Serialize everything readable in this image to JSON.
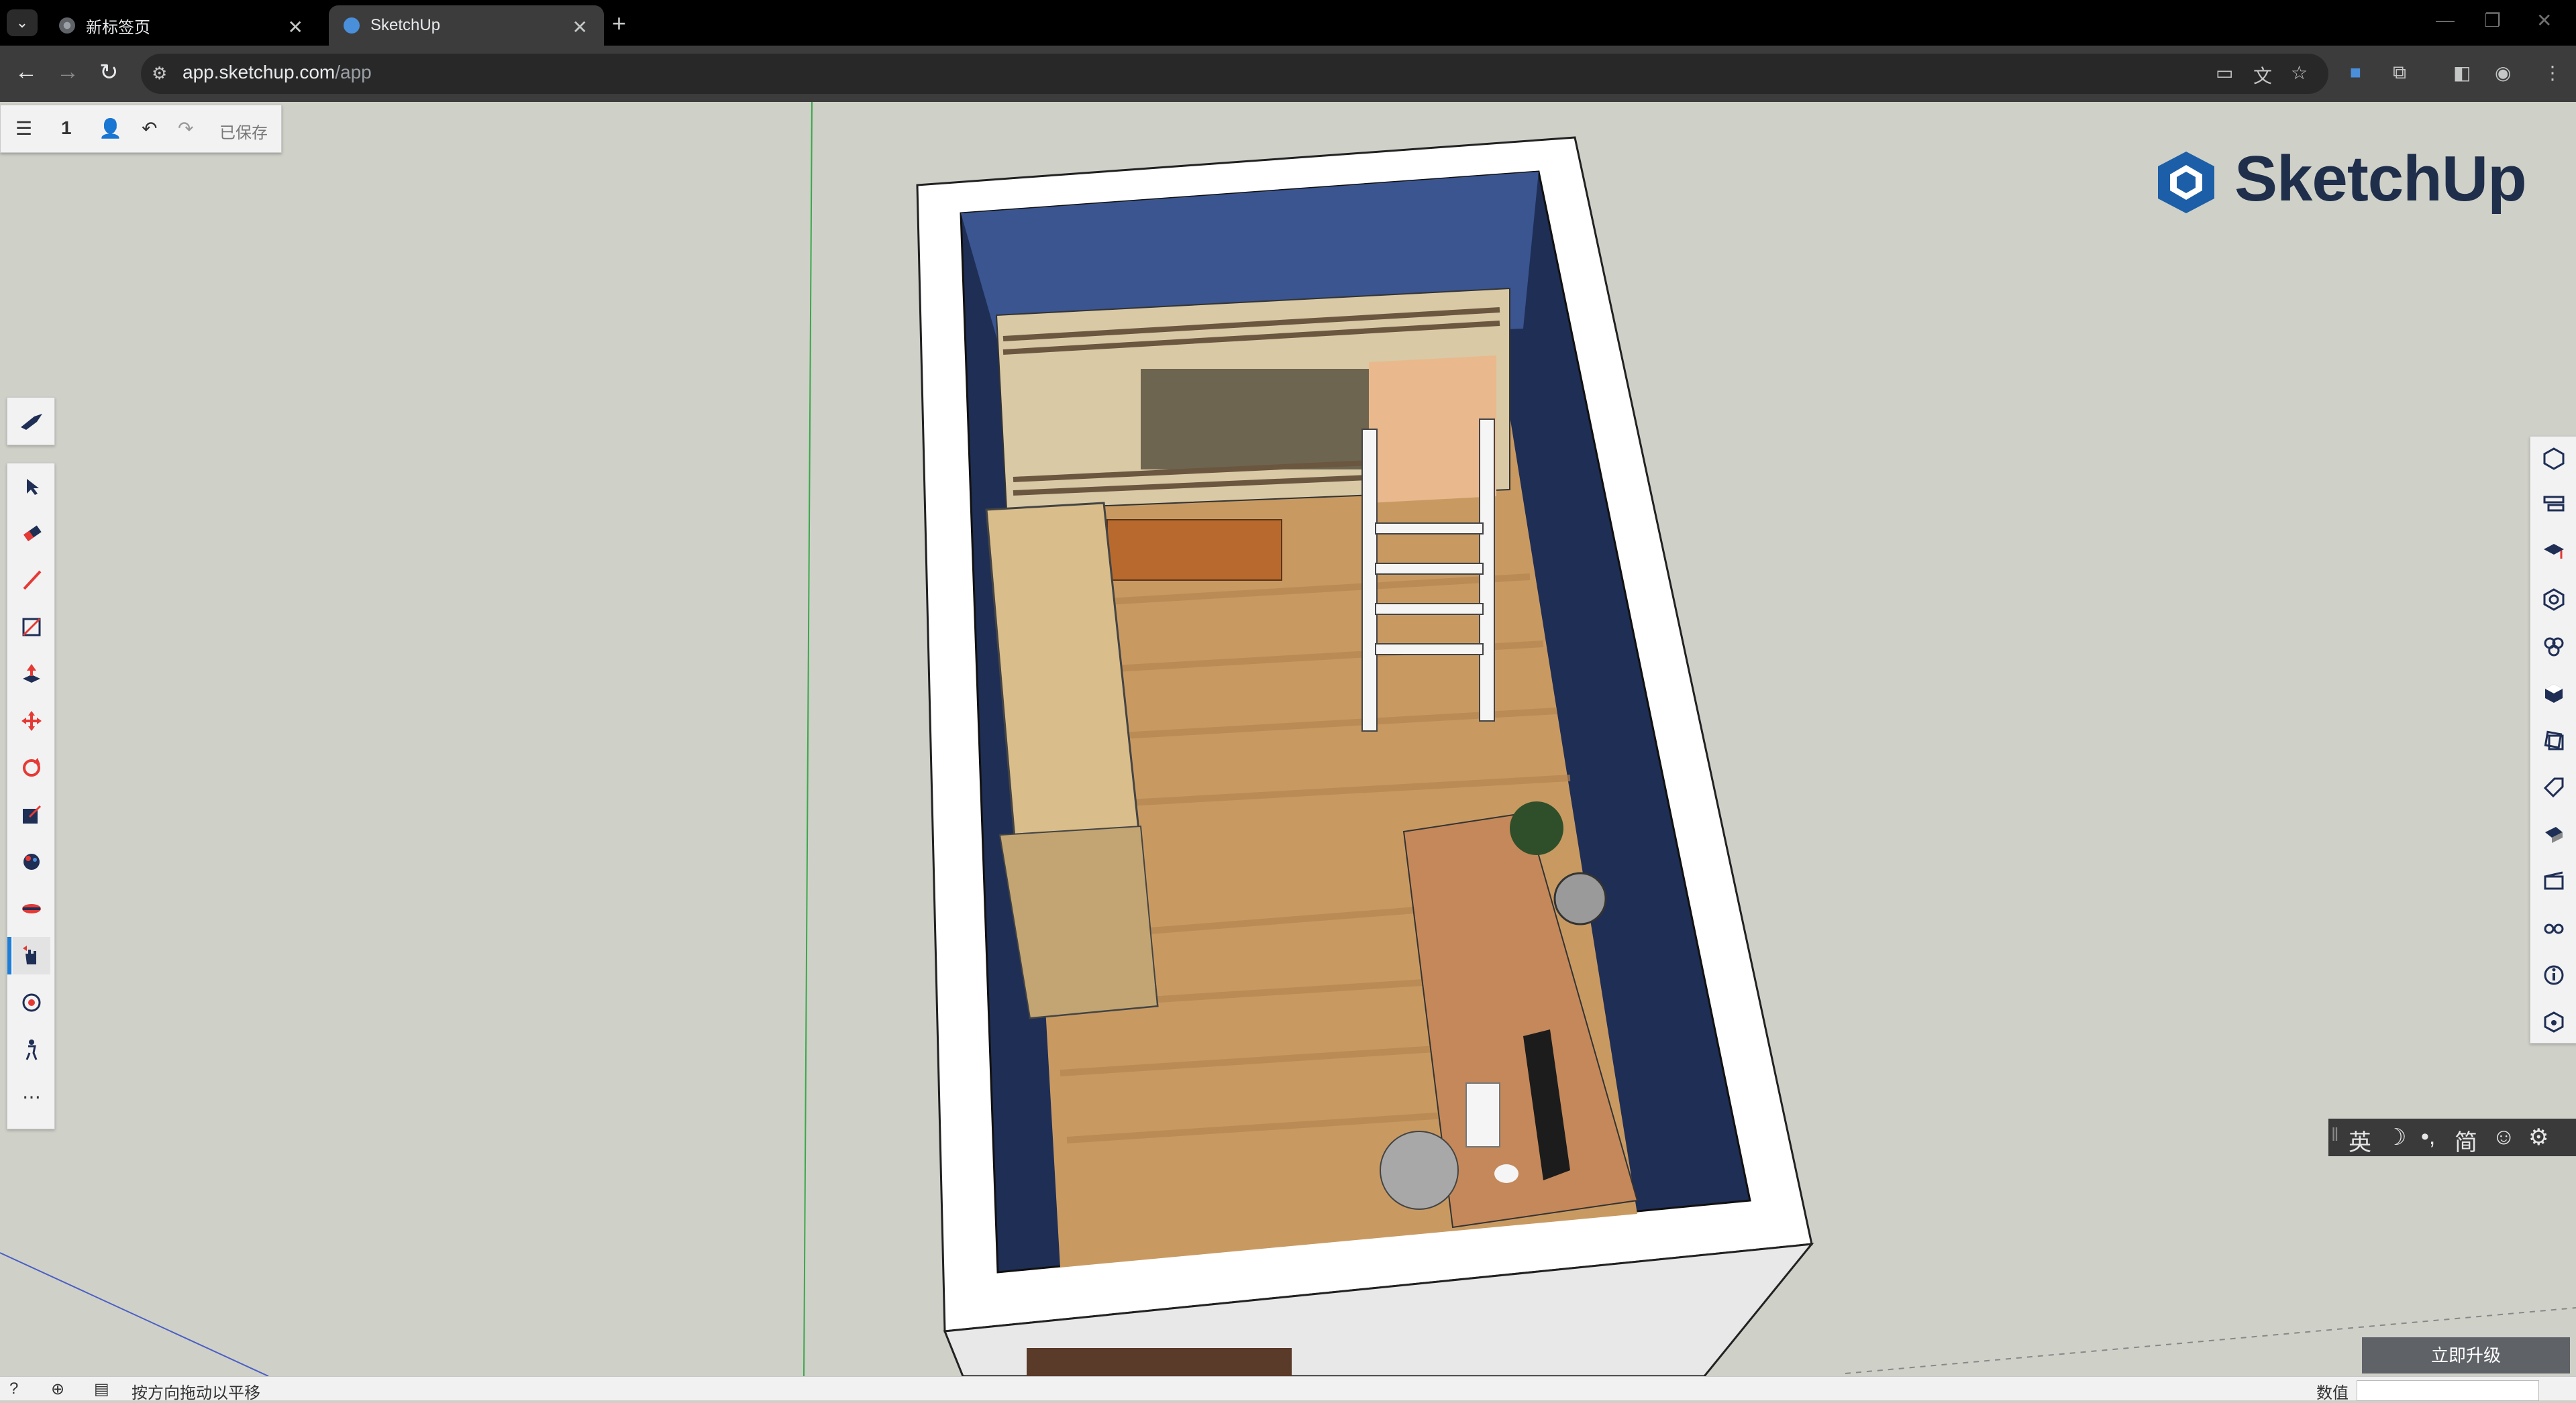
{
  "browser": {
    "tabs": [
      {
        "title": "新标签页",
        "active": false
      },
      {
        "title": "SketchUp",
        "active": true
      }
    ],
    "url_host": "app.sketchup.com",
    "url_path": "/app"
  },
  "toolbar": {
    "scene_number": "1",
    "saved_label": "已保存"
  },
  "logo": {
    "text": "SketchUp"
  },
  "ime": {
    "lang": "英",
    "simplified": "简"
  },
  "upgrade_label": "立即升级",
  "status": {
    "hint": "按方向拖动以平移",
    "value_label": "数值"
  },
  "colors": {
    "accent": "#1c7ed6",
    "wall_navy": "#1f2e55",
    "floor": "#c89a62",
    "sky": "#cfd0c8"
  }
}
